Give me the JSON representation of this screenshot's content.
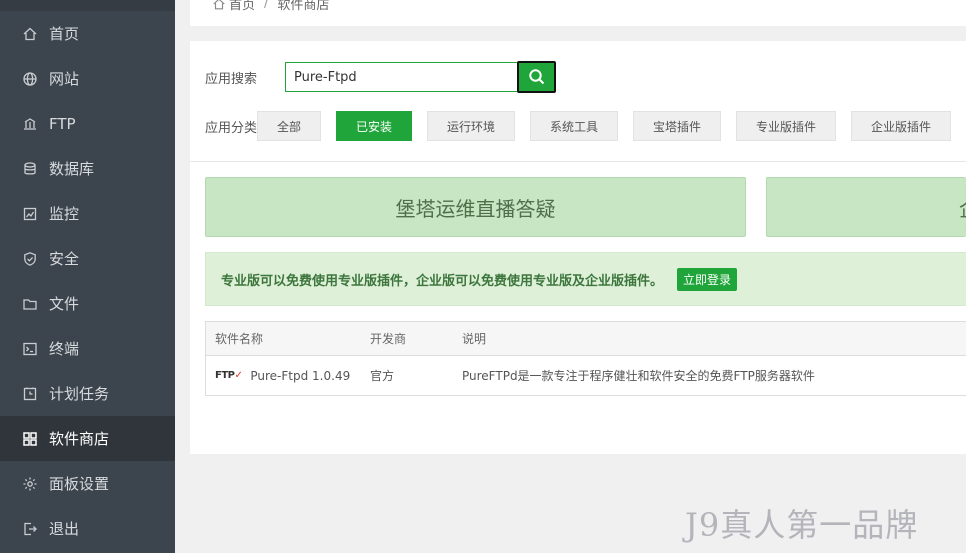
{
  "sidebar": {
    "items": [
      {
        "label": "首页",
        "icon": "home-icon"
      },
      {
        "label": "网站",
        "icon": "globe-icon"
      },
      {
        "label": "FTP",
        "icon": "ftp-icon"
      },
      {
        "label": "数据库",
        "icon": "database-icon"
      },
      {
        "label": "监控",
        "icon": "monitor-icon"
      },
      {
        "label": "安全",
        "icon": "shield-icon"
      },
      {
        "label": "文件",
        "icon": "folder-icon"
      },
      {
        "label": "终端",
        "icon": "terminal-icon"
      },
      {
        "label": "计划任务",
        "icon": "clock-icon"
      },
      {
        "label": "软件商店",
        "icon": "grid-icon"
      },
      {
        "label": "面板设置",
        "icon": "gear-icon"
      },
      {
        "label": "退出",
        "icon": "logout-icon"
      }
    ],
    "active_index": 9
  },
  "breadcrumb": {
    "home": "首页",
    "separator": "/",
    "current": "软件商店"
  },
  "search": {
    "label": "应用搜索",
    "value": "Pure-Ftpd"
  },
  "categories": {
    "label": "应用分类",
    "items": [
      "全部",
      "已安装",
      "运行环境",
      "系统工具",
      "宝塔插件",
      "专业版插件",
      "企业版插件"
    ],
    "active_index": 1
  },
  "banners": {
    "primary": "堡塔运维直播答疑",
    "secondary": "企"
  },
  "notice": {
    "text": "专业版可以免费使用专业版插件，企业版可以免费使用专业版及企业版插件。",
    "button": "立即登录"
  },
  "table": {
    "headers": [
      "软件名称",
      "开发商",
      "说明"
    ],
    "rows": [
      {
        "logo": "FTP",
        "name": "Pure-Ftpd 1.0.49",
        "developer": "官方",
        "description": "PureFTPd是一款专注于程序健壮和软件安全的免费FTP服务器软件"
      }
    ]
  },
  "watermark": "J9真人第一品牌",
  "colors": {
    "sidebar_bg": "#3c444d",
    "accent_green": "#20a53a",
    "banner_bg": "#c8e6c4",
    "notice_bg": "#dff0d8"
  }
}
